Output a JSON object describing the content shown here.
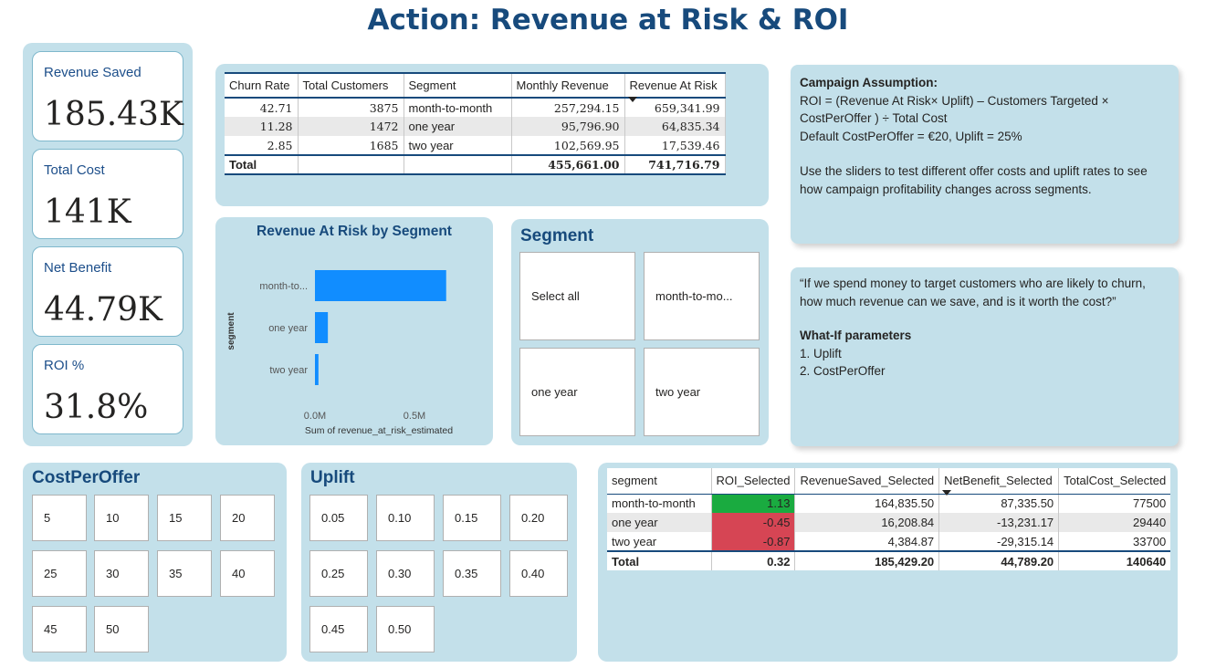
{
  "page": {
    "title": "Action: Revenue at Risk & ROI"
  },
  "kpis": [
    {
      "label": "Revenue Saved",
      "value": "185.43K"
    },
    {
      "label": "Total Cost",
      "value": "141K"
    },
    {
      "label": "Net Benefit",
      "value": "44.79K"
    },
    {
      "label": "ROI %",
      "value": "31.8%"
    }
  ],
  "top_table": {
    "headers": [
      "Churn Rate",
      "Total Customers",
      "Segment",
      "Monthly Revenue",
      "Revenue At Risk"
    ],
    "rows": [
      [
        "42.71",
        "3875",
        "month-to-month",
        "257,294.15",
        "659,341.99"
      ],
      [
        "11.28",
        "1472",
        "one year",
        "95,796.90",
        "64,835.34"
      ],
      [
        "2.85",
        "1685",
        "two year",
        "102,569.95",
        "17,539.46"
      ]
    ],
    "total": {
      "label": "Total",
      "monthly_revenue": "455,661.00",
      "revenue_at_risk": "741,716.79"
    }
  },
  "assumption": {
    "heading": "Campaign Assumption:",
    "line1": " ROI = (Revenue At Risk× Uplift) –  Customers Targeted × CostPerOffer ) ÷ Total Cost",
    "line2": " Default CostPerOffer = €20, Uplift = 25%",
    "line3": "Use the sliders to test different offer costs and uplift rates to see how campaign profitability changes across segments."
  },
  "question": {
    "text": "“If we spend money to target customers who are likely to churn, how much revenue can we save, and is it worth the cost?”",
    "params_heading": "What-If parameters",
    "param1": "1. Uplift",
    "param2": "2. CostPerOffer"
  },
  "chart_data": {
    "type": "bar",
    "title": "Revenue At Risk by Segment",
    "xlabel": "Sum of revenue_at_risk_estimated",
    "ylabel": "segment",
    "categories": [
      "month-to...",
      "one year",
      "two year"
    ],
    "values": [
      659341.99,
      64835.34,
      17539.46
    ],
    "xticks": [
      "0.0M",
      "0.5M"
    ],
    "xlim": [
      0,
      1000000
    ],
    "color": "#118dff"
  },
  "segment_slicer": {
    "title": "Segment",
    "options": [
      "Select all",
      "month-to-mo...",
      "one year",
      "two year"
    ]
  },
  "cost_slicer": {
    "title": "CostPerOffer",
    "options": [
      "5",
      "10",
      "15",
      "20",
      "25",
      "30",
      "35",
      "40",
      "45",
      "50"
    ]
  },
  "uplift_slicer": {
    "title": "Uplift",
    "options": [
      "0.05",
      "0.10",
      "0.15",
      "0.20",
      "0.25",
      "0.30",
      "0.35",
      "0.40",
      "0.45",
      "0.50"
    ]
  },
  "bottom_table": {
    "headers": [
      "segment",
      "ROI_Selected",
      "RevenueSaved_Selected",
      "NetBenefit_Selected",
      "TotalCost_Selected"
    ],
    "rows": [
      [
        "month-to-month",
        "1.13",
        "164,835.50",
        "87,335.50",
        "77500"
      ],
      [
        "one year",
        "-0.45",
        "16,208.84",
        "-13,231.17",
        "29440"
      ],
      [
        "two year",
        "-0.87",
        "4,384.87",
        "-29,315.14",
        "33700"
      ]
    ],
    "total": [
      "Total",
      "0.32",
      "185,429.20",
      "44,789.20",
      "140640"
    ],
    "colors": {
      "positive": "#1aab40",
      "negative": "#d64554"
    }
  },
  "colors": {
    "panel": "#c3e0ea",
    "title": "#174a7c",
    "accent": "#118dff"
  }
}
